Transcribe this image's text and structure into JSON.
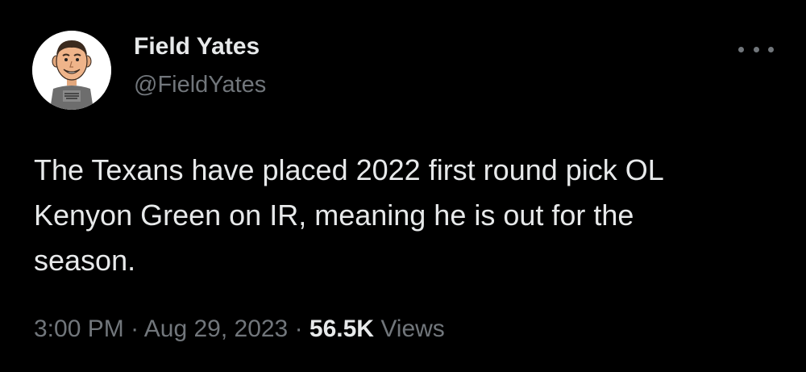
{
  "author": {
    "name": "Field Yates",
    "handle": "@FieldYates",
    "avatar_icon": "cartoon-avatar-icon"
  },
  "tweet": {
    "text": "The Texans have placed 2022 first round pick OL\nKenyon Green on IR, meaning he is out for the\nseason.",
    "time": "3:00 PM",
    "separator": " · ",
    "date": "Aug 29, 2023",
    "views_count": "56.5K",
    "views_label": " Views"
  },
  "menu": {
    "more_icon": "more-options-icon"
  },
  "colors": {
    "background": "#000000",
    "primary_text": "#e7e9ea",
    "secondary_text": "#71767b"
  }
}
